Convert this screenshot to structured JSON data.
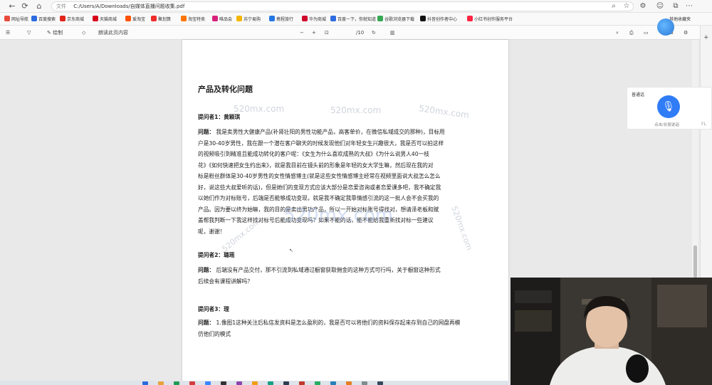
{
  "browser": {
    "file_label": "文件",
    "url": "C:/Users/A/Downloads/自媒体直播问题收集.pdf",
    "bookmarks": [
      {
        "label": "网址导航",
        "color": "#e94b3c"
      },
      {
        "label": "百度搜索",
        "color": "#2d6be0"
      },
      {
        "label": "京东商城",
        "color": "#e1251b"
      },
      {
        "label": "天猫商城",
        "color": "#d9001b"
      },
      {
        "label": "爱淘宝",
        "color": "#ff5000"
      },
      {
        "label": "聚划算",
        "color": "#ef2c2c"
      },
      {
        "label": "淘宝特卖",
        "color": "#ff7300"
      },
      {
        "label": "唯品会",
        "color": "#d8227a"
      },
      {
        "label": "苏宁易购",
        "color": "#f5b400"
      },
      {
        "label": "携程旅行",
        "color": "#2577e3"
      },
      {
        "label": "华为商城",
        "color": "#cf0a2c"
      },
      {
        "label": "百度一下，你就知道",
        "color": "#2d6be0"
      },
      {
        "label": "谷歌浏览器下载",
        "color": "#34a853"
      },
      {
        "label": "抖音创作者中心",
        "color": "#111111"
      },
      {
        "label": "小红书创作服务平台",
        "color": "#ff2442"
      }
    ],
    "bookmarks_right": "其他收藏夹"
  },
  "pdf_toolbar": {
    "draw_label": "绘制",
    "read_aloud_label": "朗读此页内容",
    "page_number": "6",
    "page_count": "/10"
  },
  "document": {
    "title": "产品及转化问题",
    "q1_label": "提问者1：黄颖琪",
    "q1_prefix": "问题：",
    "q1_lines": [
      "我是卖男性大健康产品(补肾壮阳的男性功能产品，高客单价，在微信私域成交的那种)，目标用",
      "户是30-40岁男性，我在跟一个潜在客户聊天的时候发现他们对年轻女生兴趣很大，我是否可以拍这样",
      "的视频吸引到精准且能成功转化的客户呢：《女生为什么喜欢成熟的大叔》《为什么说男人40一枝",
      "花》《如何快速把女生约出来》，就是我目前在镜头前的形象是年轻的女大学生嘛，然后现在我的对",
      "标是粉丝群体是30-40岁男性的女性情感博主(就是这些女性情感博主经常在视频里面说大叔怎么怎么",
      "好，说这些大叔爱听的话)，但是她们的变现方式应该大部分是恋爱咨询或者恋爱课多吧，我不确定我",
      "以她们作为对标账号，后端是否能够成功变现，就是我不确定我靠情感引流的这一批人会不会买我的",
      "产品。因为要以终为始嘛，我的目的是卖出男功产品，所以一开始对标账号得找对，想请泽老板和赋",
      "盖帮我判断一下我这样找对标号后能成功变现吗？如果不能的话，能不能给我重新找对标一些建议",
      "呢，谢谢！"
    ],
    "q2_label": "提问者2：璐瑶",
    "q2_prefix": "问题：",
    "q2_lines": [
      "后端没有产品交付，那不引流到私域通过橱窗获取佣金的这种方式可行吗，关于橱窗这种形式",
      "后续会有课程讲解吗？"
    ],
    "q3_label": "提问者3：理",
    "q3_prefix": "问题：",
    "q3_lines": [
      "1.像图1这种关注后私信发资料是怎么盈利的，我是否可以将他们的资料保存起来存到自己的网盘再模",
      "仿他们的模式"
    ]
  },
  "watermarks": [
    "520mx.com",
    "520mx.com",
    "520mx.com",
    "520mx.com",
    "520mx.com",
    "520mx.com"
  ],
  "voice_panel": {
    "title": "普通话",
    "hint": "点击/长按说话",
    "fl": "FL"
  }
}
